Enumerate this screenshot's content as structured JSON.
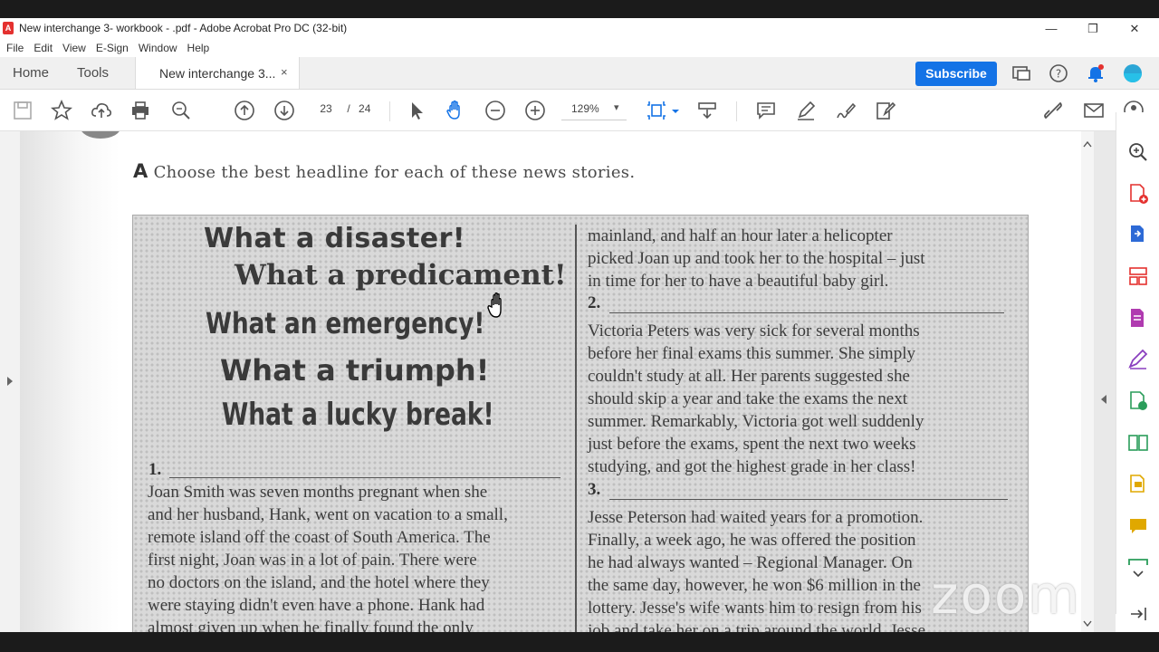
{
  "window": {
    "title": "New interchange 3- workbook - .pdf - Adobe Acrobat Pro DC (32-bit)",
    "controls": {
      "minimize": "—",
      "restore": "❐",
      "close": "✕"
    }
  },
  "menu": [
    "File",
    "Edit",
    "View",
    "E-Sign",
    "Window",
    "Help"
  ],
  "tabs": {
    "home": "Home",
    "tools": "Tools",
    "document": "New interchange 3...",
    "close": "×"
  },
  "header": {
    "subscribe": "Subscribe"
  },
  "toolbar": {
    "current_page": "23",
    "page_separator": "/",
    "total_pages": "24",
    "zoom": "129%",
    "zoom_caret": "▾"
  },
  "document": {
    "instruction_letter": "A",
    "instruction": "Choose the best headline for each of these news stories.",
    "headlines": [
      "What a disaster!",
      "What a predicament!",
      "What an emergency!",
      "What a triumph!",
      "What a lucky break!"
    ],
    "story1": {
      "number": "1.",
      "lines": [
        "Joan Smith was seven months pregnant when she",
        "and her husband, Hank, went on vacation to a small,",
        "remote island off the coast of South America. The",
        "first night, Joan was in a lot of pain. There were",
        "no doctors on the island, and the hotel where they",
        "were staying didn't even have a phone. Hank had",
        "almost given up when he finally found the only"
      ]
    },
    "story1_continued": [
      "mainland, and half an hour later a helicopter",
      "picked Joan up and took her to the hospital – just",
      "in time for her to have a beautiful baby girl."
    ],
    "story2": {
      "number": "2.",
      "lines": [
        "Victoria Peters was very sick for several months",
        "before her final exams this summer. She simply",
        "couldn't study at all. Her parents suggested she",
        "should skip a year and take the exams the next",
        "summer. Remarkably, Victoria got well suddenly",
        "just before the exams, spent the next two weeks",
        "studying, and got the highest grade in her class!"
      ]
    },
    "story3": {
      "number": "3.",
      "lines": [
        "Jesse Peterson had waited years for a promotion.",
        "Finally, a week ago, he was offered the position",
        "he had always wanted – Regional Manager. On",
        "the same day, however, he won $6 million in the",
        "lottery. Jesse's wife wants him to resign from his",
        "job and take her on a trip around the world. Jesse"
      ]
    }
  },
  "watermark": "zoom",
  "colors": {
    "accent": "#1473e6",
    "right_panel_icons": [
      "#444444",
      "#e4312f",
      "#2d6ad6",
      "#e4312f",
      "#b03bb0",
      "#8a3fbf",
      "#2a9d5a",
      "#2a9d5a",
      "#e0a800",
      "#e0a800",
      "#2a9d5a"
    ]
  }
}
